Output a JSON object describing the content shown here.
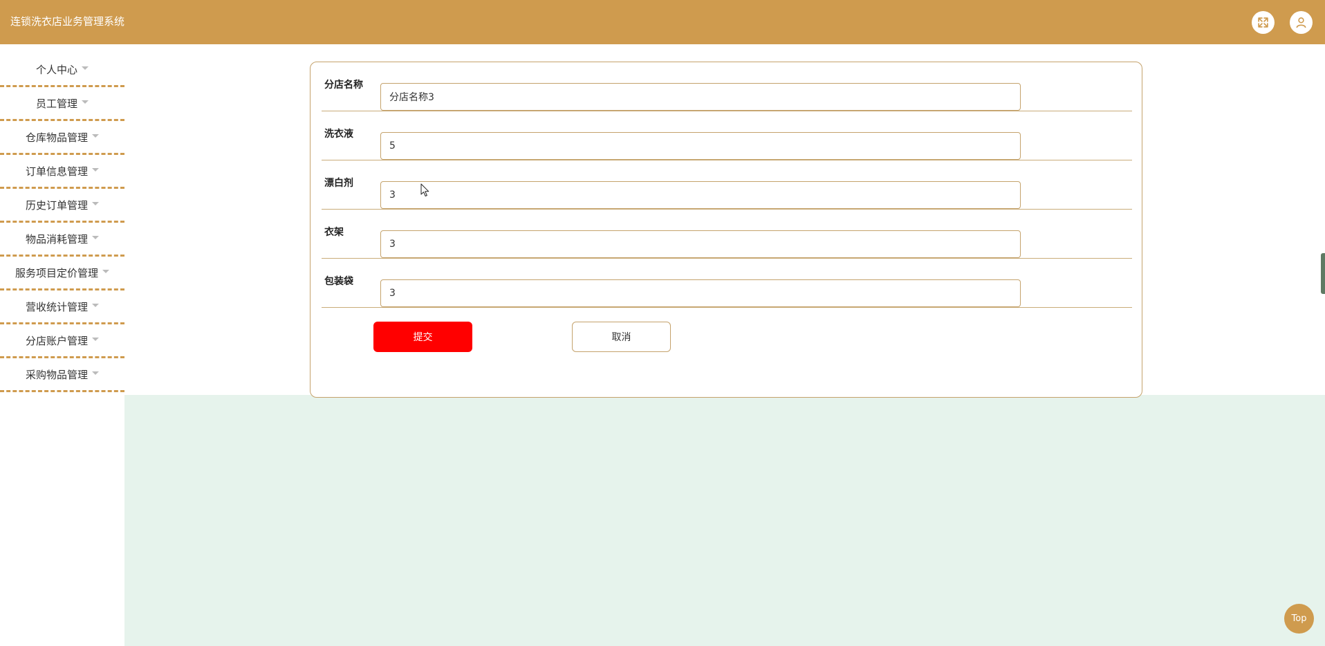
{
  "header": {
    "title": "连锁洗衣店业务管理系统",
    "fullscreen_icon": "fullscreen-expand-icon",
    "user_icon": "user-avatar-icon",
    "bg_color": "#cf9b4e"
  },
  "sidebar": {
    "items": [
      {
        "label": "个人中心"
      },
      {
        "label": "员工管理"
      },
      {
        "label": "仓库物品管理"
      },
      {
        "label": "订单信息管理"
      },
      {
        "label": "历史订单管理"
      },
      {
        "label": "物品消耗管理"
      },
      {
        "label": "服务项目定价管理"
      },
      {
        "label": "营收统计管理"
      },
      {
        "label": "分店账户管理"
      },
      {
        "label": "采购物品管理"
      }
    ]
  },
  "form": {
    "fields": [
      {
        "label": "分店名称",
        "value": "分店名称3"
      },
      {
        "label": "洗衣液",
        "value": "5"
      },
      {
        "label": "漂白剂",
        "value": "3"
      },
      {
        "label": "衣架",
        "value": "3"
      },
      {
        "label": "包装袋",
        "value": "3"
      }
    ],
    "submit_label": "提交",
    "cancel_label": "取消",
    "submit_color": "#ff0000"
  },
  "footer": {
    "top_label": "Top"
  }
}
